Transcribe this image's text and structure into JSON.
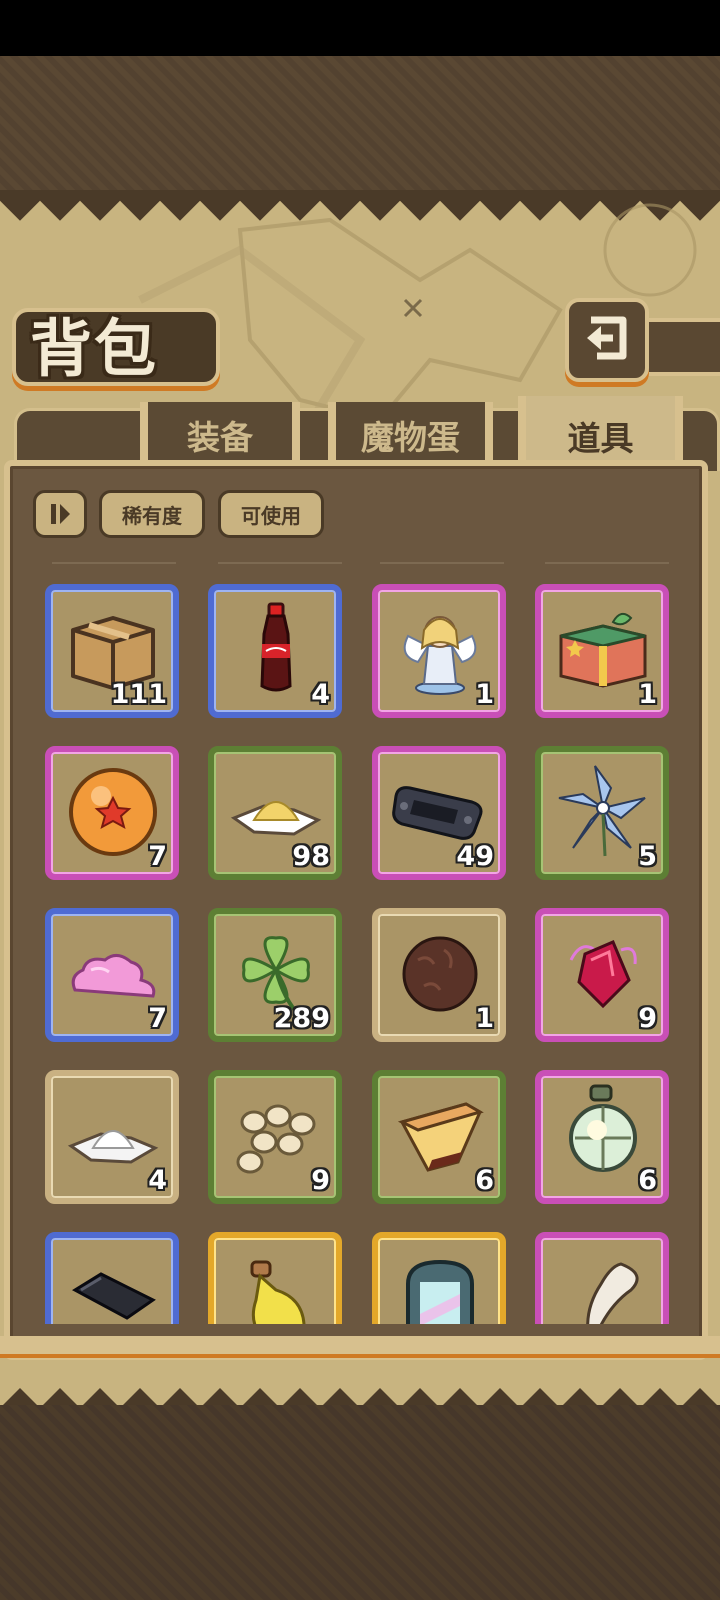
{
  "header": {
    "title": "背包"
  },
  "tabs": [
    {
      "label": "装备",
      "active": false
    },
    {
      "label": "魔物蛋",
      "active": false
    },
    {
      "label": "道具",
      "active": true
    }
  ],
  "filters": {
    "sort_icon": "sort-icon",
    "rarity_label": "稀有度",
    "usable_label": "可使用"
  },
  "colors": {
    "blue": "#4f6bd2",
    "pink": "#c94fb7",
    "green": "#5d7f34",
    "tan": "#c9b182",
    "gold": "#e3a82a"
  },
  "items": [
    {
      "icon": "cardboard-box-icon",
      "rarity": "blue",
      "count": "111"
    },
    {
      "icon": "cola-bottle-icon",
      "rarity": "blue",
      "count": "4"
    },
    {
      "icon": "angel-figurine-icon",
      "rarity": "pink",
      "count": "1"
    },
    {
      "icon": "gift-box-icon",
      "rarity": "pink",
      "count": "1"
    },
    {
      "icon": "star-orb-icon",
      "rarity": "pink",
      "count": "7"
    },
    {
      "icon": "yellow-powder-icon",
      "rarity": "green",
      "count": "98"
    },
    {
      "icon": "handheld-console-icon",
      "rarity": "pink",
      "count": "49"
    },
    {
      "icon": "blue-flower-icon",
      "rarity": "green",
      "count": "5"
    },
    {
      "icon": "pink-cloud-icon",
      "rarity": "blue",
      "count": "7"
    },
    {
      "icon": "four-leaf-clover-icon",
      "rarity": "green",
      "count": "289"
    },
    {
      "icon": "brown-fur-ball-icon",
      "rarity": "tan",
      "count": "1"
    },
    {
      "icon": "red-crystal-icon",
      "rarity": "pink",
      "count": "9"
    },
    {
      "icon": "white-powder-icon",
      "rarity": "tan",
      "count": "4"
    },
    {
      "icon": "beans-icon",
      "rarity": "green",
      "count": "9"
    },
    {
      "icon": "pudding-icon",
      "rarity": "green",
      "count": "6"
    },
    {
      "icon": "lantern-icon",
      "rarity": "pink",
      "count": "6"
    },
    {
      "icon": "black-bar-icon",
      "rarity": "blue",
      "count": ""
    },
    {
      "icon": "yellow-potion-icon",
      "rarity": "gold",
      "count": ""
    },
    {
      "icon": "rainbow-mirror-icon",
      "rarity": "gold",
      "count": ""
    },
    {
      "icon": "fang-icon",
      "rarity": "pink",
      "count": ""
    }
  ]
}
